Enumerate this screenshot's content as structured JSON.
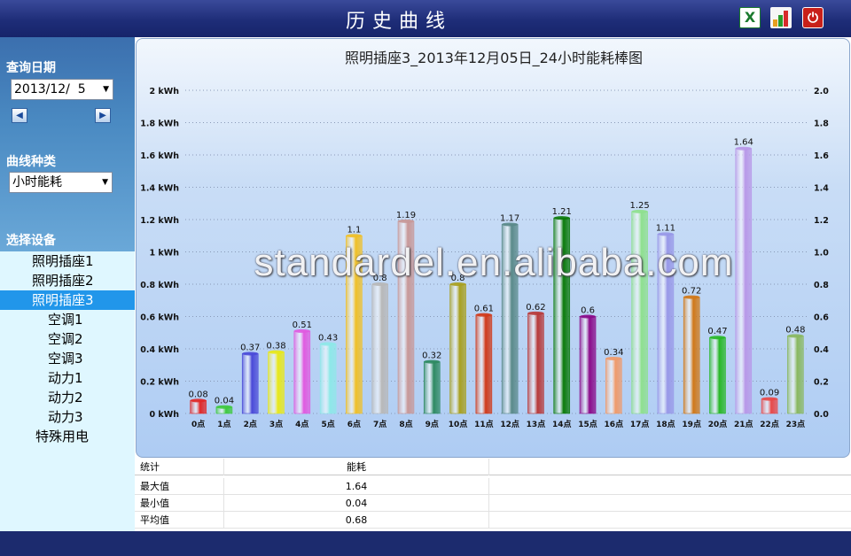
{
  "header": {
    "title": "历史曲线",
    "excel_icon": "excel-export-icon",
    "chart_icon": "bar-chart-icon",
    "power_icon": "power-icon"
  },
  "sidebar": {
    "date_label": "查询日期",
    "date_value": "2013/12/  5",
    "prev_icon": "chevron-left-icon",
    "next_icon": "chevron-right-icon",
    "curve_label": "曲线种类",
    "curve_value": "小时能耗",
    "device_label": "选择设备",
    "devices": [
      {
        "label": "照明插座1",
        "level": 1,
        "selected": false
      },
      {
        "label": "照明插座2",
        "level": 1,
        "selected": false
      },
      {
        "label": "照明插座3",
        "level": 1,
        "selected": true
      },
      {
        "label": "空调1",
        "level": 2,
        "selected": false
      },
      {
        "label": "空调2",
        "level": 2,
        "selected": false
      },
      {
        "label": "空调3",
        "level": 2,
        "selected": false
      },
      {
        "label": "动力1",
        "level": 2,
        "selected": false
      },
      {
        "label": "动力2",
        "level": 2,
        "selected": false
      },
      {
        "label": "动力3",
        "level": 2,
        "selected": false
      },
      {
        "label": "特殊用电",
        "level": 1,
        "selected": false
      }
    ]
  },
  "watermark": "standardel.en.alibaba.com",
  "chart_data": {
    "type": "bar",
    "title": "照明插座3_2013年12月05日_24小时能耗棒图",
    "categories": [
      "0点",
      "1点",
      "2点",
      "3点",
      "4点",
      "5点",
      "6点",
      "7点",
      "8点",
      "9点",
      "10点",
      "11点",
      "12点",
      "13点",
      "14点",
      "15点",
      "16点",
      "17点",
      "18点",
      "19点",
      "20点",
      "21点",
      "22点",
      "23点"
    ],
    "values": [
      0.08,
      0.04,
      0.37,
      0.38,
      0.51,
      0.43,
      1.1,
      0.8,
      1.19,
      0.32,
      0.8,
      0.61,
      1.17,
      0.62,
      1.21,
      0.6,
      0.34,
      1.25,
      1.11,
      0.72,
      0.47,
      1.64,
      0.09,
      0.48
    ],
    "labels": [
      "0.08",
      "0.04",
      "0.37",
      "0.38",
      "0.51",
      "0.43",
      "1.1",
      "0.8",
      "1.19",
      "0.32",
      "0.8",
      "0.61",
      "1.17",
      "0.62",
      "1.21",
      "0.6",
      "0.34",
      "1.25",
      "1.11",
      "0.72",
      "0.47",
      "1.64",
      "0.09",
      "0.48"
    ],
    "colors": [
      "#e02828",
      "#3ec93e",
      "#4a4ad8",
      "#e8e81a",
      "#e05ae0",
      "#8ee8e8",
      "#f0c028",
      "#b8b8b8",
      "#c89898",
      "#2e8a62",
      "#a8a020",
      "#d03a1a",
      "#5a8a8a",
      "#b83a3a",
      "#0a7a0a",
      "#8a0a8a",
      "#f09a6a",
      "#8ee08e",
      "#9898e8",
      "#d07818",
      "#28b828",
      "#b898e8",
      "#e84848",
      "#8ab860"
    ],
    "ylim": [
      0,
      2
    ],
    "left_ticks": [
      "0 kWh",
      "0.2 kWh",
      "0.4 kWh",
      "0.6 kWh",
      "0.8 kWh",
      "1 kWh",
      "1.2 kWh",
      "1.4 kWh",
      "1.6 kWh",
      "1.8 kWh",
      "2 kWh"
    ],
    "right_ticks": [
      "0.0",
      "0.2",
      "0.4",
      "0.6",
      "0.8",
      "1.0",
      "1.2",
      "1.4",
      "1.6",
      "1.8",
      "2.0"
    ],
    "grid": true
  },
  "stats": {
    "headers": [
      "统计",
      "能耗"
    ],
    "rows": [
      {
        "label": "最大值",
        "value": "1.64"
      },
      {
        "label": "最小值",
        "value": "0.04"
      },
      {
        "label": "平均值",
        "value": "0.68"
      }
    ]
  }
}
